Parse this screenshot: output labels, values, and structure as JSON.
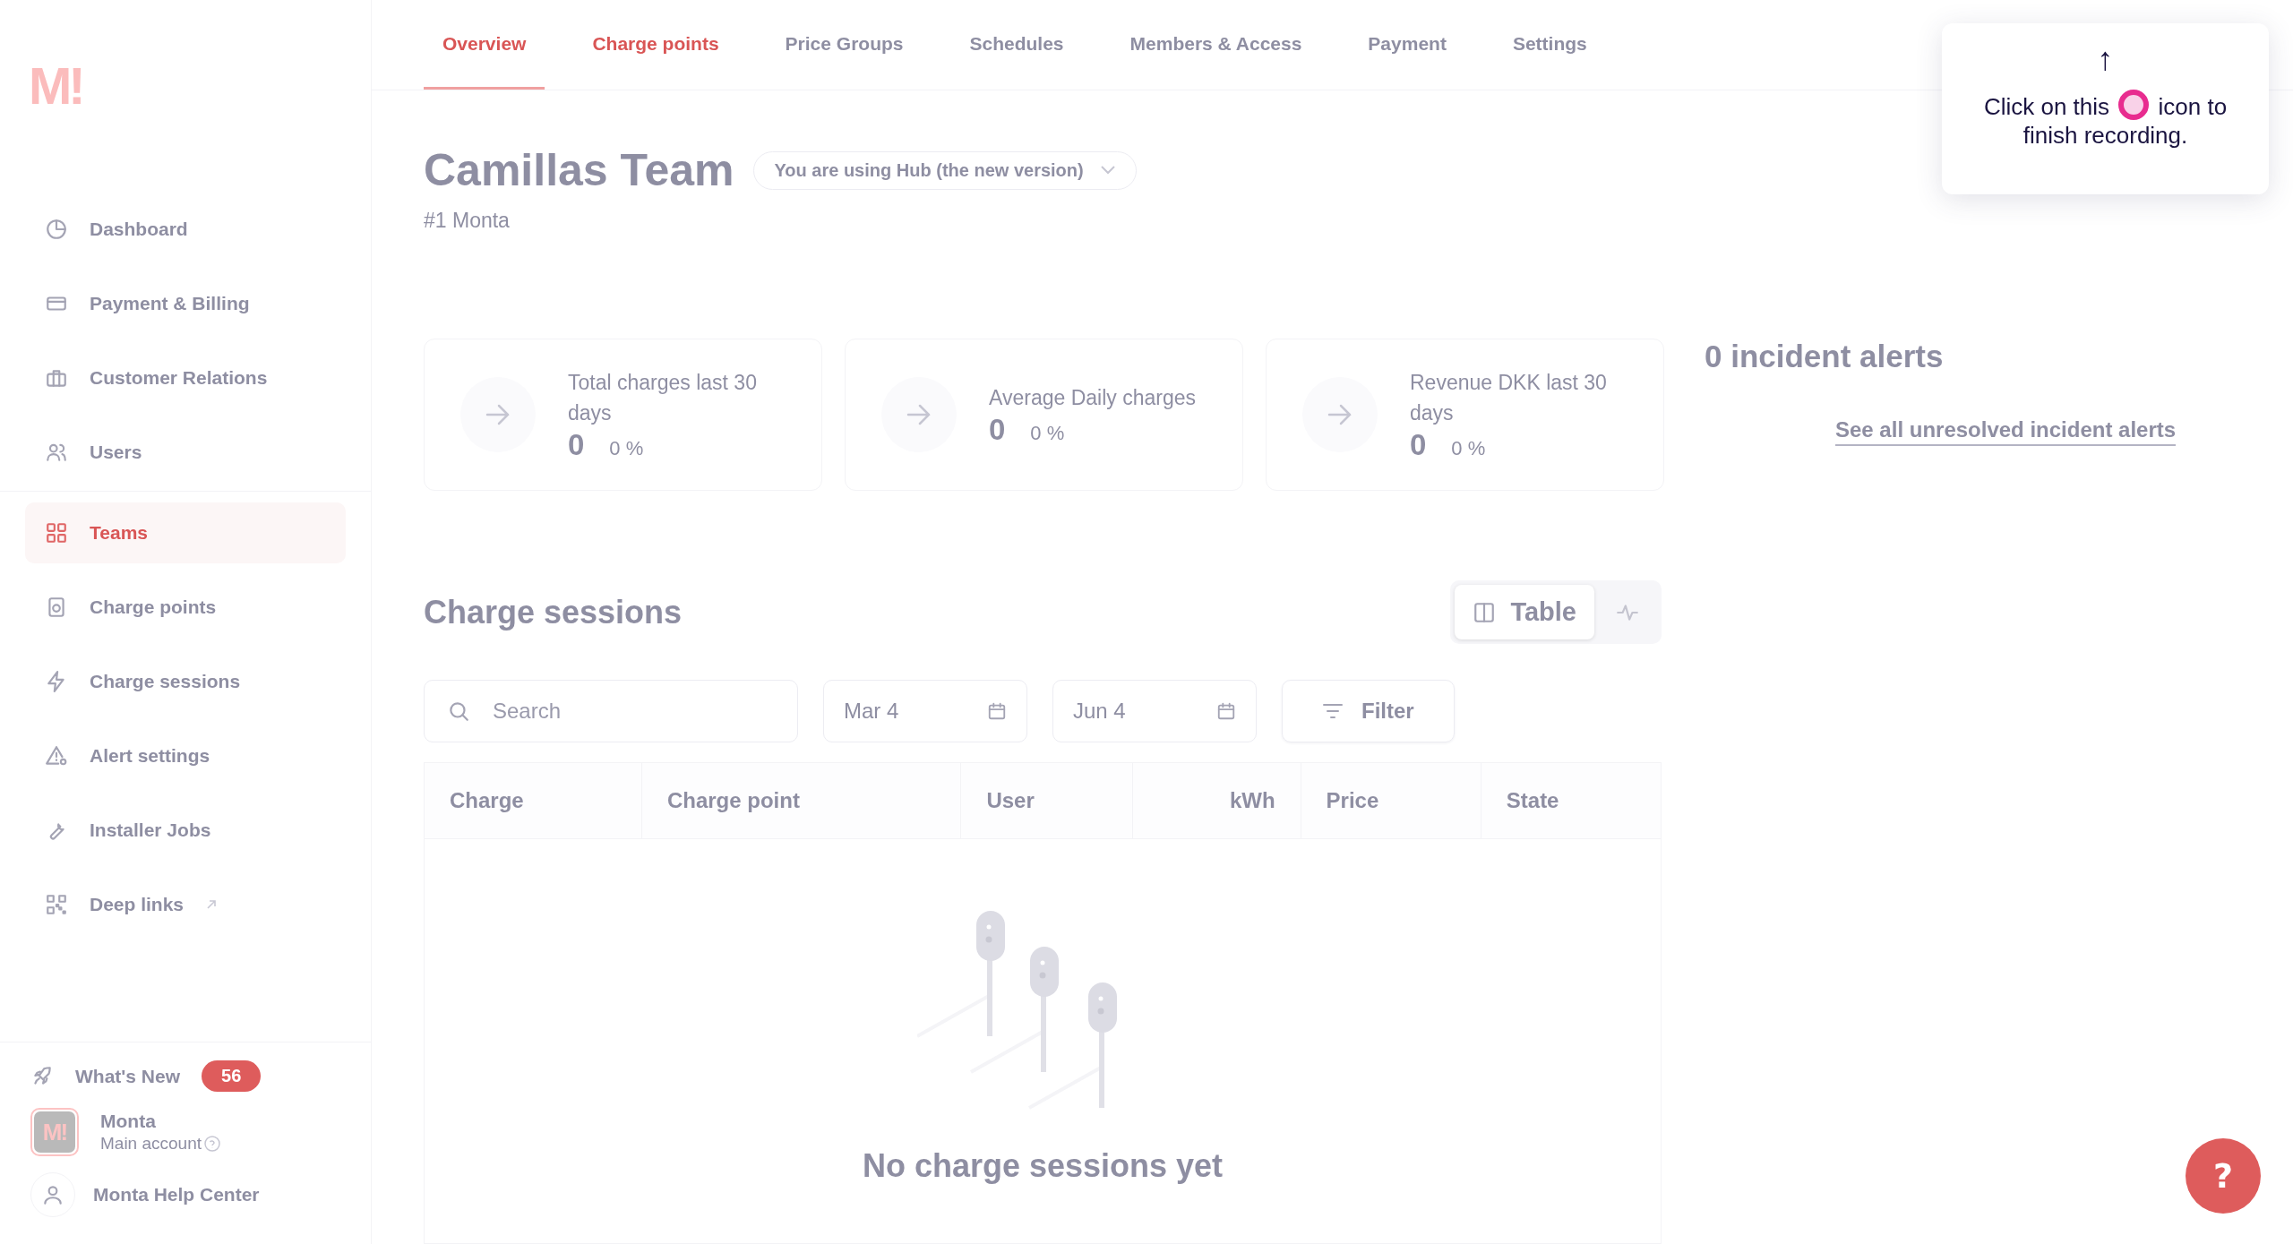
{
  "logo": "M!",
  "sidebar": {
    "groups": [
      [
        {
          "label": "Dashboard",
          "selected": false
        },
        {
          "label": "Payment & Billing",
          "selected": false
        },
        {
          "label": "Customer Relations",
          "selected": false
        },
        {
          "label": "Users",
          "selected": false
        }
      ],
      [
        {
          "label": "Teams",
          "selected": true
        },
        {
          "label": "Charge points",
          "selected": false
        },
        {
          "label": "Charge sessions",
          "selected": false
        },
        {
          "label": "Alert settings",
          "selected": false
        },
        {
          "label": "Installer Jobs",
          "selected": false
        },
        {
          "label": "Deep links",
          "selected": false,
          "external": true
        }
      ]
    ],
    "whats_new": {
      "label": "What's New",
      "badge": "56"
    },
    "account": {
      "name": "Monta",
      "subtitle": "Main account",
      "avatar_text": "M!"
    },
    "help_center": "Monta Help Center"
  },
  "tabs": [
    {
      "label": "Overview",
      "selected": true,
      "hover": false
    },
    {
      "label": "Charge points",
      "selected": false,
      "hover": true
    },
    {
      "label": "Price Groups",
      "selected": false,
      "hover": false
    },
    {
      "label": "Schedules",
      "selected": false,
      "hover": false
    },
    {
      "label": "Members & Access",
      "selected": false,
      "hover": false
    },
    {
      "label": "Payment",
      "selected": false,
      "hover": false
    },
    {
      "label": "Settings",
      "selected": false,
      "hover": false
    }
  ],
  "team": {
    "title": "Camillas Team",
    "version_select": "You are using Hub (the new version)",
    "subtitle": "#1 Monta"
  },
  "stats": [
    {
      "label": "Total charges last 30 days",
      "value": "0",
      "change": "0 %"
    },
    {
      "label": "Average Daily charges",
      "value": "0",
      "change": "0 %"
    },
    {
      "label": "Revenue DKK last 30 days",
      "value": "0",
      "change": "0 %"
    }
  ],
  "incidents": {
    "title": "0 incident alerts",
    "link": "See all unresolved incident alerts"
  },
  "sessions": {
    "title": "Charge sessions",
    "view_toggle": [
      {
        "kind": "table",
        "label": "Table",
        "selected": true
      },
      {
        "kind": "chart",
        "selected": false
      }
    ],
    "search": {
      "placeholder": "Search"
    },
    "date_from": "Mar 4",
    "date_to": "Jun 4",
    "filter": "Filter",
    "columns": [
      {
        "label": "Charge"
      },
      {
        "label": "Charge point"
      },
      {
        "label": "User"
      },
      {
        "label": "kWh"
      },
      {
        "label": "Price"
      },
      {
        "label": "State"
      }
    ],
    "empty": "No charge sessions yet"
  },
  "tooltip": {
    "arrow": "↑",
    "text_before": "Click on this",
    "text_after": "icon to finish recording."
  },
  "help_button": "?"
}
